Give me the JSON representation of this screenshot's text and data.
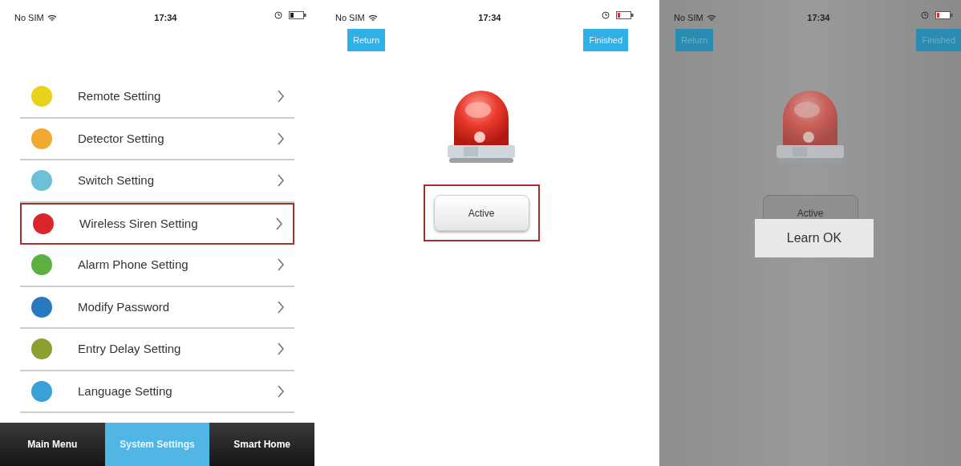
{
  "screens": [
    {
      "kind": "menu",
      "status_bar": {
        "carrier": "No SIM",
        "time": "17:34"
      },
      "items": [
        {
          "label": "Remote Setting",
          "color": "#e8d21c",
          "highlighted": false
        },
        {
          "label": "Detector Setting",
          "color": "#f0a830",
          "highlighted": false
        },
        {
          "label": "Switch Setting",
          "color": "#6cc0d8",
          "highlighted": false
        },
        {
          "label": "Wireless Siren Setting",
          "color": "#d8262c",
          "highlighted": true
        },
        {
          "label": "Alarm Phone Setting",
          "color": "#5cb040",
          "highlighted": false
        },
        {
          "label": "Modify Password",
          "color": "#2a78c0",
          "highlighted": false
        },
        {
          "label": "Entry Delay Setting",
          "color": "#8aa030",
          "highlighted": false
        },
        {
          "label": "Language Setting",
          "color": "#3aa0d8",
          "highlighted": false
        }
      ],
      "tabs": [
        {
          "label": "Main Menu",
          "selected": false
        },
        {
          "label": "System Settings",
          "selected": true
        },
        {
          "label": "Smart Home",
          "selected": false
        }
      ]
    },
    {
      "kind": "device",
      "dimmed": false,
      "status_bar": {
        "carrier": "No SIM",
        "time": "17:34"
      },
      "return_button": "Return",
      "finished_button": "Finished",
      "action_button": {
        "label": "Active",
        "highlighted": true
      }
    },
    {
      "kind": "device",
      "dimmed": true,
      "status_bar": {
        "carrier": "No SIM",
        "time": "17:34"
      },
      "return_button": "Return",
      "finished_button": "Finished",
      "action_button": {
        "label": "Active",
        "highlighted": false
      },
      "toast": "Learn OK"
    }
  ]
}
